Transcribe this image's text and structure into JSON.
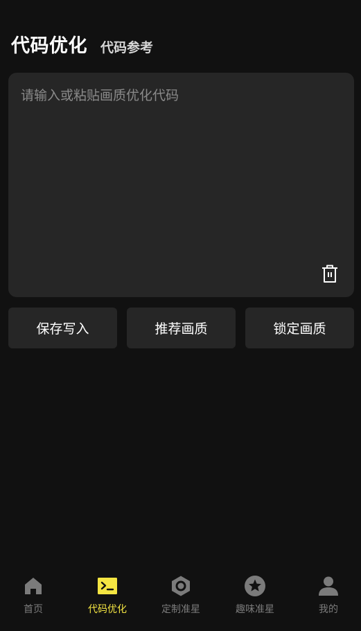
{
  "header": {
    "title": "代码优化",
    "subtitle": "代码参考"
  },
  "editor": {
    "placeholder": "请输入或粘贴画质优化代码",
    "value": ""
  },
  "actions": {
    "save_label": "保存写入",
    "recommend_label": "推荐画质",
    "lock_label": "锁定画质"
  },
  "nav": {
    "items": [
      {
        "label": "首页",
        "icon": "home-icon"
      },
      {
        "label": "代码优化",
        "icon": "terminal-icon",
        "active": true
      },
      {
        "label": "定制准星",
        "icon": "hexagon-nut-icon"
      },
      {
        "label": "趣味准星",
        "icon": "star-circle-icon"
      },
      {
        "label": "我的",
        "icon": "user-icon"
      }
    ]
  },
  "colors": {
    "background": "#111111",
    "panel": "#262626",
    "accent": "#f4e542",
    "inactive": "#7b7b7b"
  }
}
